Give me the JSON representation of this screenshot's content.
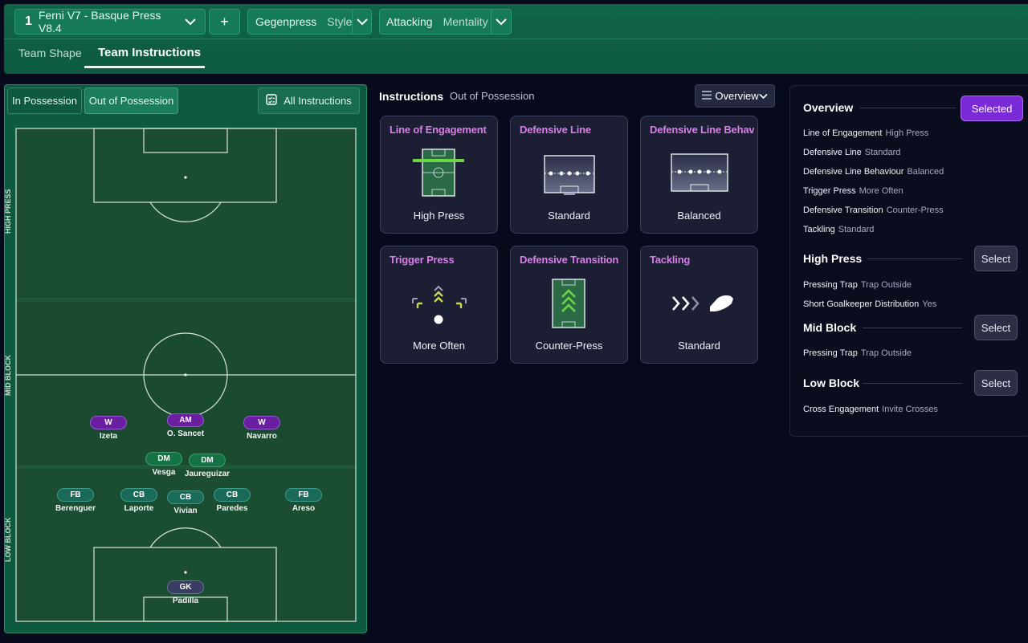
{
  "header": {
    "tactic_number": "1",
    "tactic_name": "Ferni V7 - Basque Press V8.4",
    "add_label": "+",
    "style_value": "Gegenpress",
    "style_label": "Style",
    "mentality_value": "Attacking",
    "mentality_label": "Mentality",
    "tabs": [
      {
        "label": "Team Shape",
        "active": false
      },
      {
        "label": "Team Instructions",
        "active": true
      }
    ]
  },
  "left": {
    "tabs": [
      "In Possession",
      "Out of Possession"
    ],
    "active_tab": "Out of Possession",
    "all_instructions": "All Instructions",
    "zones": [
      "HIGH PRESS",
      "MID BLOCK",
      "LOW BLOCK"
    ],
    "players": [
      {
        "pos": "W",
        "name": "Izeta",
        "line": "attack"
      },
      {
        "pos": "AM",
        "name": "O. Sancet",
        "line": "attack"
      },
      {
        "pos": "W",
        "name": "Navarro",
        "line": "attack"
      },
      {
        "pos": "DM",
        "name": "Vesga",
        "line": "mid"
      },
      {
        "pos": "DM",
        "name": "Jaureguizar",
        "line": "mid"
      },
      {
        "pos": "FB",
        "name": "Berenguer",
        "line": "def"
      },
      {
        "pos": "CB",
        "name": "Laporte",
        "line": "def"
      },
      {
        "pos": "CB",
        "name": "Vivian",
        "line": "def"
      },
      {
        "pos": "CB",
        "name": "Paredes",
        "line": "def"
      },
      {
        "pos": "FB",
        "name": "Areso",
        "line": "def"
      },
      {
        "pos": "GK",
        "name": "Padilla",
        "line": "gk"
      }
    ]
  },
  "middle": {
    "title": "Instructions",
    "subtitle": "Out of Possession",
    "view_dropdown": "Overview",
    "cards": [
      {
        "title": "Line of Engagement",
        "value": "High Press"
      },
      {
        "title": "Defensive Line",
        "value": "Standard"
      },
      {
        "title": "Defensive Line Behaviour",
        "value": "Balanced"
      },
      {
        "title": "Trigger Press",
        "value": "More Often"
      },
      {
        "title": "Defensive Transition",
        "value": "Counter-Press"
      },
      {
        "title": "Tackling",
        "value": "Standard"
      }
    ]
  },
  "right": {
    "sections": [
      {
        "title": "Overview",
        "button": "Selected",
        "items": [
          {
            "k": "Line of Engagement",
            "v": "High Press"
          },
          {
            "k": "Defensive Line",
            "v": "Standard"
          },
          {
            "k": "Defensive Line Behaviour",
            "v": "Balanced"
          },
          {
            "k": "Trigger Press",
            "v": "More Often"
          },
          {
            "k": "Defensive Transition",
            "v": "Counter-Press"
          },
          {
            "k": "Tackling",
            "v": "Standard"
          }
        ]
      },
      {
        "title": "High Press",
        "button": "Select",
        "items": [
          {
            "k": "Pressing Trap",
            "v": "Trap Outside"
          },
          {
            "k": "Short Goalkeeper Distribution",
            "v": "Yes"
          }
        ]
      },
      {
        "title": "Mid Block",
        "button": "Select",
        "items": [
          {
            "k": "Pressing Trap",
            "v": "Trap Outside"
          }
        ]
      },
      {
        "title": "Low Block",
        "button": "Select",
        "items": [
          {
            "k": "Cross Engagement",
            "v": "Invite Crosses"
          }
        ]
      }
    ]
  },
  "colors": {
    "header_green": "#116548",
    "pitch": "#1b4e33",
    "card_title": "#d97ee8",
    "selected_purple": "#7a2ad6"
  }
}
